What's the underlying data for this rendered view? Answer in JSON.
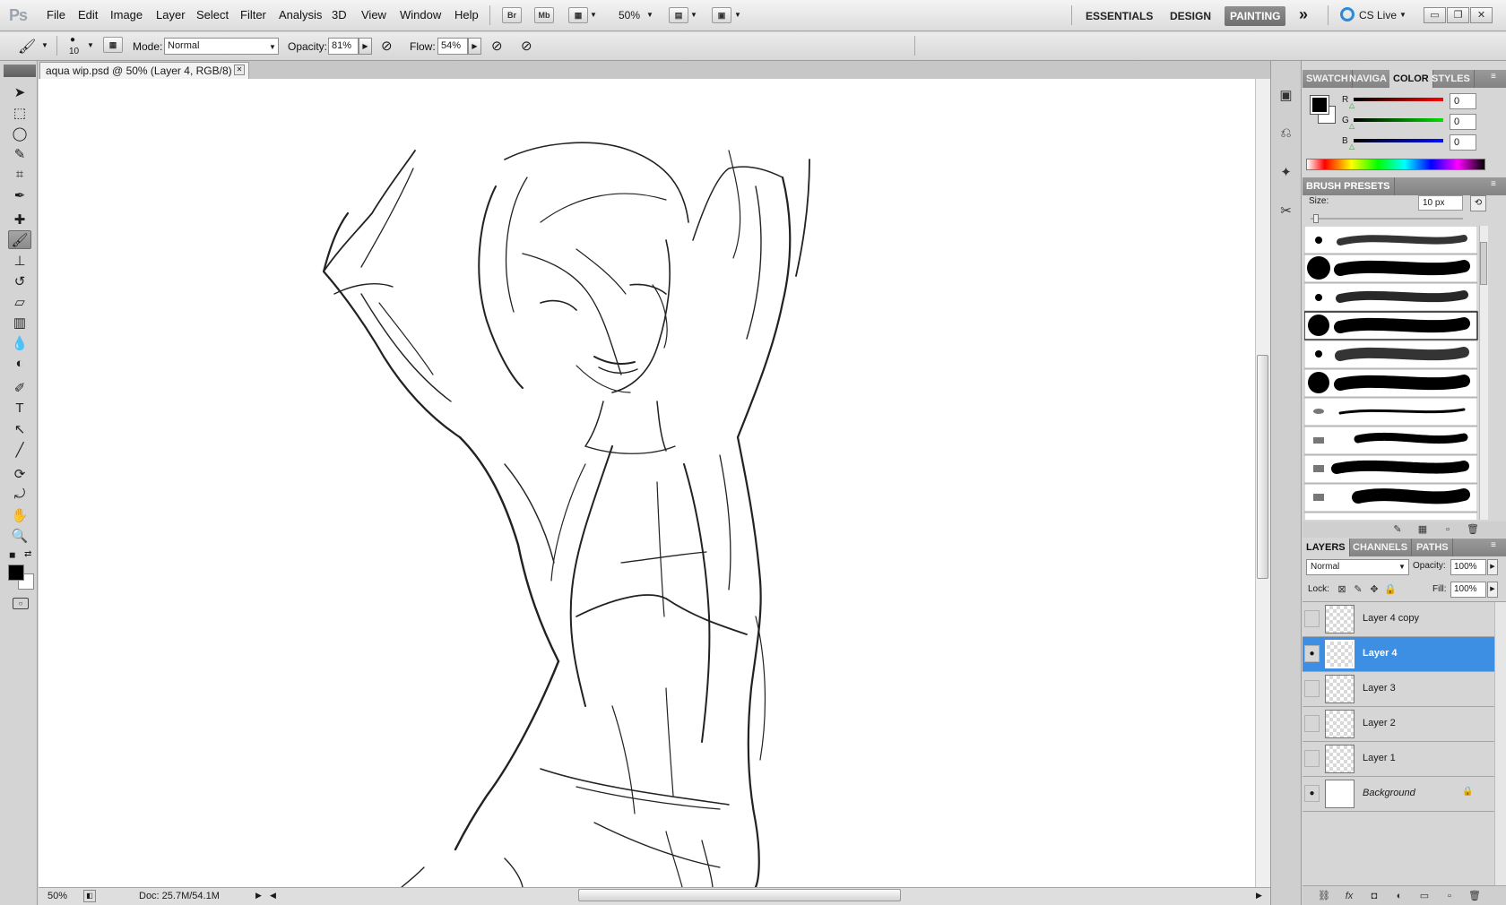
{
  "app": {
    "logo": "Ps",
    "menu": [
      "File",
      "Edit",
      "Image",
      "Layer",
      "Select",
      "Filter",
      "Analysis",
      "3D",
      "View",
      "Window",
      "Help"
    ],
    "bridge_btn": "Br",
    "minibridge_btn": "Mb",
    "zoom": "50%",
    "workspaces": [
      "ESSENTIALS",
      "DESIGN",
      "PAINTING"
    ],
    "active_workspace": "PAINTING",
    "more": "»",
    "cslive": "CS Live",
    "window_controls": [
      "▭",
      "❐",
      "✕"
    ]
  },
  "options": {
    "brush_size": "10",
    "mode_label": "Mode:",
    "mode_value": "Normal",
    "opacity_label": "Opacity:",
    "opacity_value": "81%",
    "flow_label": "Flow:",
    "flow_value": "54%"
  },
  "document": {
    "tab_title": "aqua wip.psd @ 50% (Layer 4, RGB/8) *",
    "close": "✕",
    "zoom": "50%",
    "doc_info": "Doc: 25.7M/54.1M"
  },
  "panels": {
    "top_tabs": [
      "SWATCH",
      "NAVIGA",
      "COLOR",
      "STYLES"
    ],
    "active_top_tab": "COLOR",
    "color": {
      "channels": [
        {
          "label": "R",
          "value": "0",
          "color": "#e01010"
        },
        {
          "label": "G",
          "value": "0",
          "color": "#10c010"
        },
        {
          "label": "B",
          "value": "0",
          "color": "#1020e0"
        }
      ]
    },
    "brush_presets": {
      "title": "BRUSH PRESETS",
      "size_label": "Size:",
      "size_value": "10 px"
    },
    "layers": {
      "tabs": [
        "LAYERS",
        "CHANNELS",
        "PATHS"
      ],
      "active_tab": "LAYERS",
      "blend": "Normal",
      "opacity_label": "Opacity:",
      "opacity_value": "100%",
      "lock_label": "Lock:",
      "fill_label": "Fill:",
      "fill_value": "100%",
      "items": [
        {
          "name": "Layer 4 copy",
          "visible": false,
          "selected": false
        },
        {
          "name": "Layer 4",
          "visible": true,
          "selected": true
        },
        {
          "name": "Layer 3",
          "visible": false,
          "selected": false
        },
        {
          "name": "Layer 2",
          "visible": false,
          "selected": false
        },
        {
          "name": "Layer 1",
          "visible": false,
          "selected": false
        },
        {
          "name": "Background",
          "visible": true,
          "selected": false
        }
      ],
      "eye_icon": "●"
    }
  }
}
